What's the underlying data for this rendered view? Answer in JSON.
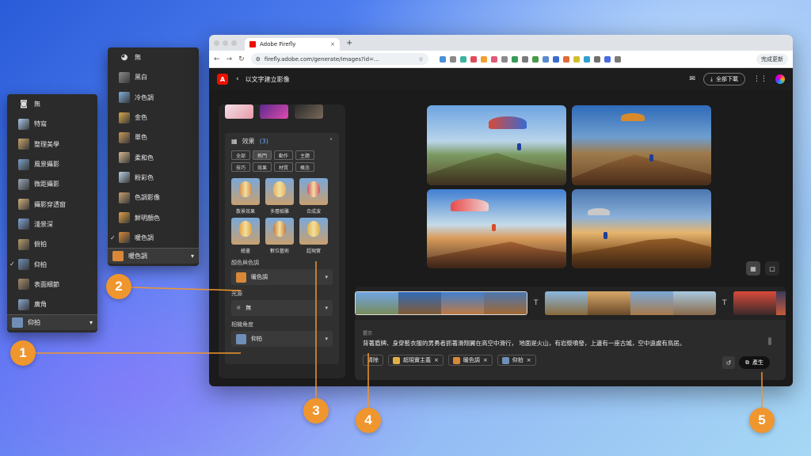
{
  "menu_camera": {
    "items": [
      {
        "label": "無",
        "icon": "camera-icon"
      },
      {
        "label": "特寫",
        "color": "#a9c8ea"
      },
      {
        "label": "整理美學",
        "color": "#c8a36a"
      },
      {
        "label": "風景攝影",
        "color": "#7aa0c8"
      },
      {
        "label": "微距攝影",
        "color": "#9aa8b8"
      },
      {
        "label": "攝影穿透窗",
        "color": "#d0b07a"
      },
      {
        "label": "淺景深",
        "color": "#7fa4d8"
      },
      {
        "label": "俯拍",
        "color": "#b89a6a"
      },
      {
        "label": "仰拍",
        "color": "#6f8fb8",
        "checked": true
      },
      {
        "label": "表面細節",
        "color": "#a88c6a"
      },
      {
        "label": "廣角",
        "color": "#8aa8d0"
      }
    ],
    "footer_label": "仰拍"
  },
  "menu_color": {
    "items": [
      {
        "label": "無",
        "icon": "palette-icon"
      },
      {
        "label": "黑白",
        "color": "#8a8a8a"
      },
      {
        "label": "冷色調",
        "color": "#7eb0e0"
      },
      {
        "label": "金色",
        "color": "#d8a848"
      },
      {
        "label": "單色",
        "color": "#c89858"
      },
      {
        "label": "柔和色",
        "color": "#d8b890"
      },
      {
        "label": "粉彩色",
        "color": "#b8d0e8"
      },
      {
        "label": "色調影像",
        "color": "#c8a070"
      },
      {
        "label": "鮮明顏色",
        "color": "#e0a040"
      },
      {
        "label": "暖色調",
        "color": "#d88838",
        "checked": true
      }
    ],
    "footer_label": "暖色調"
  },
  "browser": {
    "tab_title": "Adobe Firefly",
    "url": "firefly.adobe.com/generate/images?id=...",
    "update_label": "完成更新"
  },
  "app": {
    "title": "以文字建立影像",
    "download_label": "全部下載"
  },
  "panel": {
    "effects_title": "效果",
    "effects_count": "(3)",
    "filter_chips": [
      {
        "label": "全部"
      },
      {
        "label": "熱門",
        "active": true
      },
      {
        "label": "動作"
      },
      {
        "label": "主題"
      },
      {
        "label": "技巧"
      },
      {
        "label": "效果"
      },
      {
        "label": "材質"
      },
      {
        "label": "概念"
      }
    ],
    "effects": [
      {
        "label": "散景效果",
        "color": "#d88a4a"
      },
      {
        "label": "多層紙雕",
        "color": "#e8b060"
      },
      {
        "label": "合成波",
        "color": "#d0506a"
      },
      {
        "label": "繪畫",
        "color": "#e8a040"
      },
      {
        "label": "數位藝術",
        "color": "#c8783a"
      },
      {
        "label": "超現實",
        "color": "#e0b048"
      }
    ],
    "color_tone_label": "顏色與色調",
    "color_tone_value": "暖色調",
    "light_label": "光源",
    "light_value": "無",
    "camera_label": "相機角度",
    "camera_value": "仰拍"
  },
  "prompt": {
    "label": "提示",
    "text": "背著盾牌、身穿藍衣服的男勇者抓著滑翔翼在高空中滑行， 地面是火山，有岩漿噴發，上邊有一座古城，空中遠處有鳥居。",
    "clear_label": "清除",
    "tags": [
      {
        "label": "超現實主義",
        "color": "#e0b048"
      },
      {
        "label": "暖色調",
        "color": "#d88838"
      },
      {
        "label": "仰拍",
        "color": "#6f8fb8"
      }
    ],
    "generate_label": "產生"
  },
  "callouts": [
    "1",
    "2",
    "3",
    "4",
    "5"
  ],
  "colors": {
    "accent": "#eb1000",
    "callout": "#f0962e"
  }
}
